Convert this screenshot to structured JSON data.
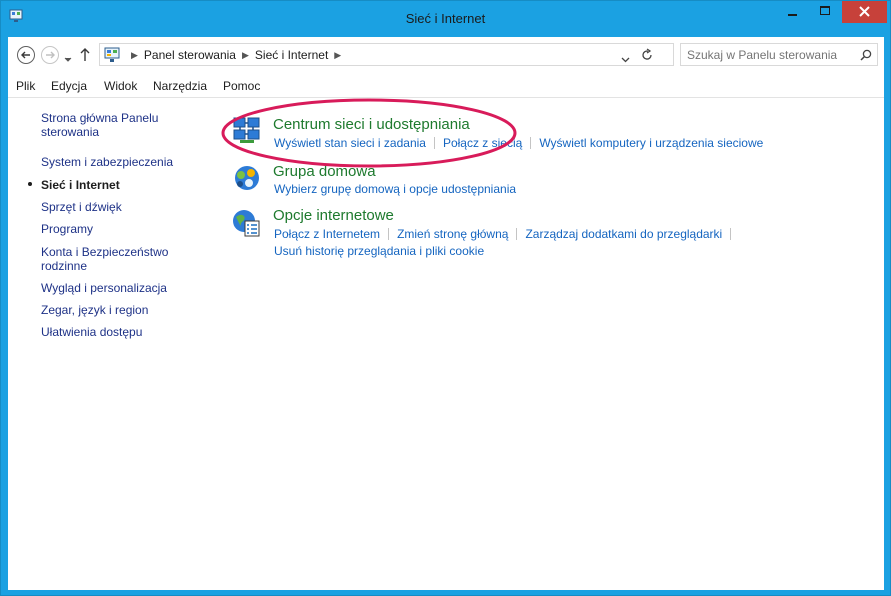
{
  "window": {
    "title": "Sieć i Internet"
  },
  "nav": {
    "breadcrumb": [
      "Panel sterowania",
      "Sieć i Internet"
    ],
    "search_placeholder": "Szukaj w Panelu sterowania"
  },
  "menu": {
    "items": [
      "Plik",
      "Edycja",
      "Widok",
      "Narzędzia",
      "Pomoc"
    ]
  },
  "sidebar": {
    "items": [
      "Strona główna Panelu sterowania",
      "System i zabezpieczenia",
      "Sieć i Internet",
      "Sprzęt i dźwięk",
      "Programy",
      "Konta i Bezpieczeństwo rodzinne",
      "Wygląd i personalizacja",
      "Zegar, język i region",
      "Ułatwienia dostępu"
    ],
    "current": "Sieć i Internet"
  },
  "categories": [
    {
      "title": "Centrum sieci i udostępniania",
      "icon": "network-center-icon",
      "links": [
        "Wyświetl stan sieci i zadania",
        "Połącz z siecią",
        "Wyświetl komputery i urządzenia sieciowe"
      ]
    },
    {
      "title": "Grupa domowa",
      "icon": "homegroup-icon",
      "links": [
        "Wybierz grupę domową i opcje udostępniania"
      ]
    },
    {
      "title": "Opcje internetowe",
      "icon": "internet-options-icon",
      "links": [
        "Połącz z Internetem",
        "Zmień stronę główną",
        "Zarządzaj dodatkami do przeglądarki",
        "Usuń historię przeglądania i pliki cookie"
      ]
    }
  ],
  "colors": {
    "titlebar": "#1ba1e2",
    "close_button": "#c7413a",
    "category_title": "#1e7a2e",
    "link": "#1565c0",
    "highlight": "#d81b5a"
  }
}
